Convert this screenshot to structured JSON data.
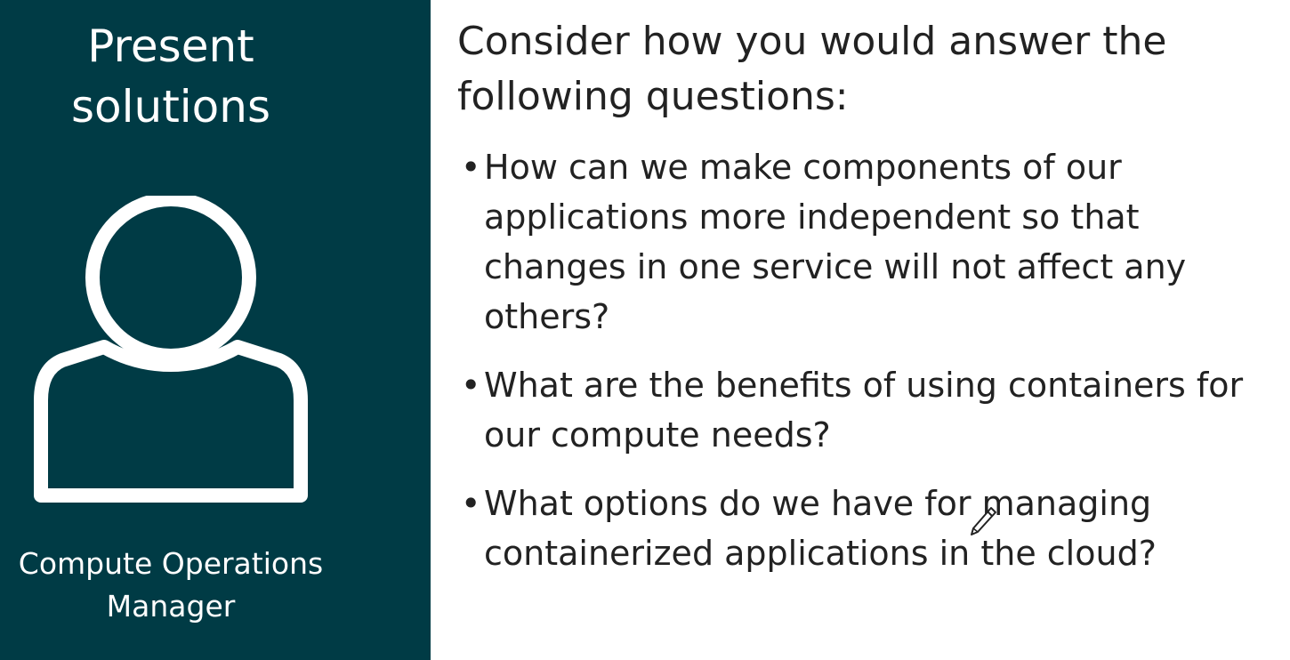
{
  "left_panel": {
    "title_lines": [
      "Present",
      "solutions"
    ],
    "icon": "user-silhouette-icon",
    "role_lines": [
      "Compute Operations",
      "Manager"
    ],
    "background_color": "#003b45"
  },
  "right_panel": {
    "intro": "Consider how you would answer the following questions:",
    "bullet_glyph": "•",
    "questions": [
      "How can we make components of our applications more independent so that changes in one service will not affect any others?",
      "What are the benefits of using containers for our compute needs?",
      "What options do we have for managing containerized applications in the cloud?"
    ]
  },
  "cursor": {
    "icon": "pen-cursor-icon"
  }
}
